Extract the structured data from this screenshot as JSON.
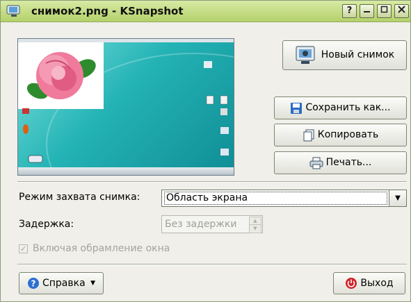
{
  "window": {
    "title": "снимок2.png - KSnapshot",
    "controls": {
      "help": "?",
      "minimize": "_",
      "maximize": "□",
      "close": "X"
    }
  },
  "preview": {
    "description_icon": "screenshot-preview"
  },
  "buttons": {
    "new_snapshot": "Новый снимок",
    "save_as": "Сохранить как...",
    "copy": "Копировать",
    "print": "Печать...",
    "help": "Справка",
    "quit": "Выход"
  },
  "capture_mode": {
    "label": "Режим захвата снимка:",
    "value": "Область экрана"
  },
  "delay": {
    "label": "Задержка:",
    "value": "Без задержки"
  },
  "include_decorations": {
    "label": "Включая обрамление окна",
    "checked": true,
    "enabled": false
  },
  "colors": {
    "titlebar": "#b4d16a",
    "desktop": "#24b3b5",
    "accent_red": "#d2232a",
    "help_blue": "#2d6fd2"
  }
}
